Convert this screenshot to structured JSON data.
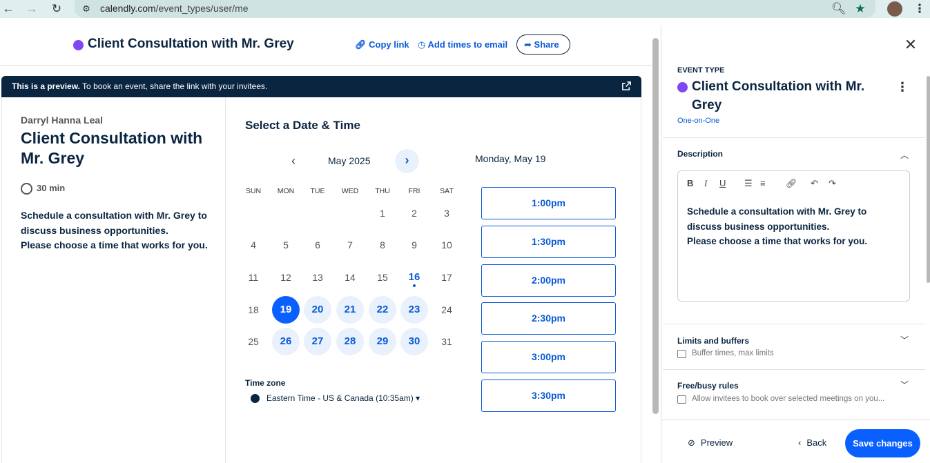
{
  "browser": {
    "url_domain": "calendly.com",
    "url_path": "/event_types/user/me"
  },
  "header": {
    "title": "Client Consultation with Mr. Grey",
    "copy_link": "Copy link",
    "add_times": "Add times to email",
    "share": "Share"
  },
  "preview": {
    "banner_bold": "This is a preview.",
    "banner_text": " To book an event, share the link with your invitees.",
    "host": "Darryl Hanna Leal",
    "title": "Client Consultation with Mr. Grey",
    "duration": "30 min",
    "description_line1": "Schedule a consultation with Mr. Grey to discuss business opportunities.",
    "description_line2": "Please choose a time that works for you.",
    "select_heading": "Select a Date & Time",
    "month": "May 2025",
    "weekdays": [
      "SUN",
      "MON",
      "TUE",
      "WED",
      "THU",
      "FRI",
      "SAT"
    ],
    "selected_date_label": "Monday, May 19",
    "timezone_label": "Time zone",
    "timezone_value": "Eastern Time - US & Canada (10:35am) ▾",
    "slots": [
      "1:00pm",
      "1:30pm",
      "2:00pm",
      "2:30pm",
      "3:00pm",
      "3:30pm"
    ]
  },
  "calendar_days": [
    [
      "",
      "",
      "",
      "",
      "1",
      "2",
      "3"
    ],
    [
      "4",
      "5",
      "6",
      "7",
      "8",
      "9",
      "10"
    ],
    [
      "11",
      "12",
      "13",
      "14",
      "15",
      "16",
      "17"
    ],
    [
      "18",
      "19",
      "20",
      "21",
      "22",
      "23",
      "24"
    ],
    [
      "25",
      "26",
      "27",
      "28",
      "29",
      "30",
      "31"
    ]
  ],
  "panel": {
    "event_type_label": "EVENT TYPE",
    "title": "Client Consultation with Mr. Grey",
    "kind": "One-on-One",
    "description_heading": "Description",
    "editor_line1": "Schedule a consultation with Mr. Grey to discuss business opportunities.",
    "editor_line2": "Please choose a time that works for you.",
    "limits_heading": "Limits and buffers",
    "limits_sub": "Buffer times, max limits",
    "freebusy_heading": "Free/busy rules",
    "freebusy_sub": "Allow invitees to book over selected meetings on you...",
    "preview_btn": "Preview",
    "back_btn": "Back",
    "save_btn": "Save changes"
  },
  "colors": {
    "brand_blue": "#0a60ff",
    "event_purple": "#8247f5",
    "navy": "#0a2540"
  }
}
